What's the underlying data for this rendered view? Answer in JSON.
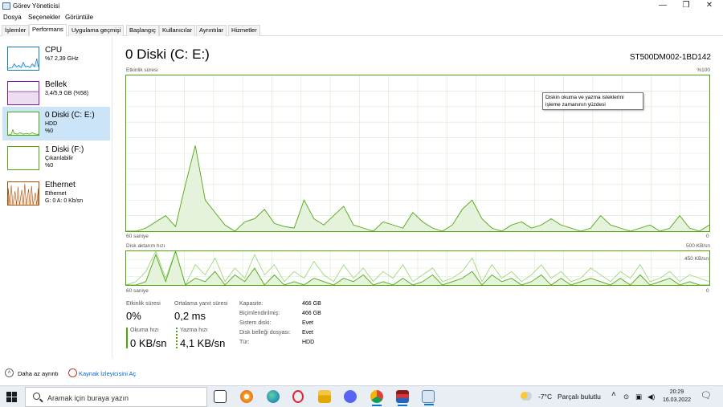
{
  "window": {
    "title": "Görev Yöneticisi",
    "minimize": "—",
    "maximize": "❐",
    "close": "✕"
  },
  "menu": {
    "file": "Dosya",
    "options": "Seçenekler",
    "view": "Görüntüle"
  },
  "tabs": [
    "İşlemler",
    "Performans",
    "Uygulama geçmişi",
    "Başlangıç",
    "Kullanıcılar",
    "Ayrıntılar",
    "Hizmetler"
  ],
  "sidebar": {
    "items": [
      {
        "name": "CPU",
        "sub1": "%7 2,39 GHz",
        "sub2": ""
      },
      {
        "name": "Bellek",
        "sub1": "3,4/5,9 GB (%58)",
        "sub2": ""
      },
      {
        "name": "0 Diski (C: E:)",
        "sub1": "HDD",
        "sub2": "%0"
      },
      {
        "name": "1 Diski (F:)",
        "sub1": "Çıkarılabilir",
        "sub2": "%0"
      },
      {
        "name": "Ethernet",
        "sub1": "Ethernet",
        "sub2": "G: 0 A: 0 Kb/sn"
      }
    ]
  },
  "main": {
    "title": "0 Diski (C: E:)",
    "model": "ST500DM002-1BD142",
    "graph1": {
      "label": "Etkinlik süresi",
      "max": "%100",
      "time_left": "60 saniye",
      "time_right": "0"
    },
    "graph2": {
      "label": "Disk aktarım hızı",
      "max": "500 KB/sn",
      "mid": "450 KB/sn",
      "time_left": "60 saniye",
      "time_right": "0"
    },
    "tooltip": "Diskin okuma ve yazma isteklerini işleme zamanının yüzdesi"
  },
  "stats": {
    "active_time_label": "Etkinlik süresi",
    "active_time_value": "0%",
    "resp_time_label": "Ortalama yanıt süresi",
    "resp_time_value": "0,2 ms",
    "read_label": "Okuma hızı",
    "read_value": "0 KB/sn",
    "write_label": "Yazma hızı",
    "write_value": "4,1 KB/sn",
    "props": [
      {
        "k": "Kapasite:",
        "v": "466 GB"
      },
      {
        "k": "Biçimlendirilmiş:",
        "v": "466 GB"
      },
      {
        "k": "Sistem diski:",
        "v": "Evet"
      },
      {
        "k": "Disk belleği dosyası:",
        "v": "Evet"
      },
      {
        "k": "Tür:",
        "v": "HDD"
      }
    ]
  },
  "footer": {
    "fewer_details": "Daha az ayrıntı",
    "resource_monitor": "Kaynak İzleyicisini Aç"
  },
  "taskbar": {
    "search_placeholder": "Aramak için buraya yazın",
    "weather_temp": "-7°C",
    "weather_text": "Parçalı bulutlu",
    "time": "20:29",
    "date": "16.03.2022"
  },
  "colors": {
    "disk_green": "#4da60c",
    "selected_bg": "#cce4f7",
    "link": "#0066cc"
  },
  "activity_series": [
    0,
    0,
    2,
    6,
    10,
    3,
    30,
    55,
    20,
    12,
    4,
    0,
    6,
    8,
    14,
    5,
    3,
    2,
    20,
    8,
    4,
    10,
    16,
    4,
    2,
    0,
    6,
    4,
    2,
    12,
    6,
    2,
    0,
    4,
    14,
    20,
    8,
    2,
    0,
    4,
    6,
    2,
    4,
    8,
    4,
    2,
    0,
    2,
    10,
    4,
    2,
    0,
    2,
    4,
    0,
    2,
    10,
    2,
    0,
    4
  ],
  "transfer_series_a": [
    0,
    10,
    40,
    100,
    20,
    100,
    0,
    60,
    30,
    80,
    10,
    50,
    20,
    90,
    30,
    60,
    10,
    40,
    20,
    70,
    30,
    10,
    60,
    20,
    50,
    10,
    40,
    20,
    60,
    10,
    30,
    50,
    10,
    20,
    40,
    80,
    10,
    60,
    20,
    40,
    10,
    30,
    60,
    20,
    40,
    10,
    20,
    50,
    30,
    10,
    40,
    20,
    60,
    10,
    20,
    40,
    10,
    30,
    20,
    10
  ],
  "transfer_series_b": [
    0,
    0,
    10,
    90,
    10,
    100,
    0,
    20,
    10,
    40,
    0,
    30,
    10,
    50,
    0,
    30,
    0,
    10,
    0,
    20,
    10,
    0,
    20,
    10,
    30,
    0,
    10,
    0,
    20,
    0,
    10,
    30,
    0,
    10,
    20,
    40,
    0,
    30,
    10,
    20,
    0,
    10,
    30,
    0,
    20,
    0,
    10,
    20,
    10,
    0,
    20,
    0,
    30,
    0,
    10,
    20,
    0,
    10,
    0,
    0
  ]
}
